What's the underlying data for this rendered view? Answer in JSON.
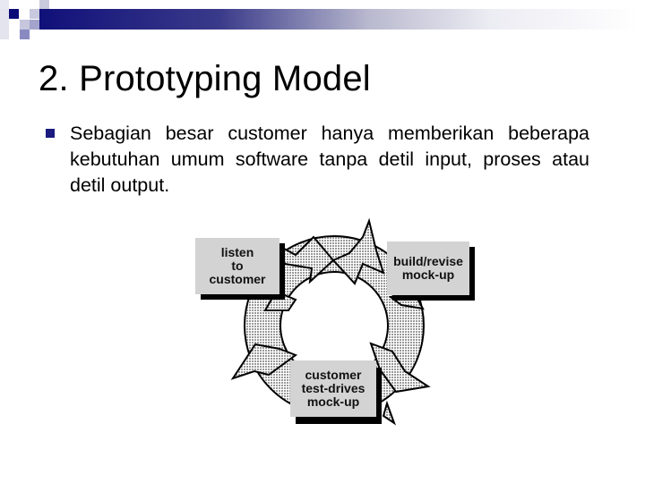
{
  "slide": {
    "title": "2. Prototyping Model",
    "bullets": [
      {
        "icon": "square-bullet-icon",
        "text": "Sebagian besar customer hanya memberikan beberapa kebutuhan umum software tanpa detil input, proses atau detil output."
      }
    ]
  },
  "colors": {
    "accent_dark": "#10107a",
    "bullet": "#1a1a80",
    "box_fill": "#d3d3d3"
  },
  "diagram": {
    "boxes": [
      {
        "id": "listen",
        "lines": [
          "listen",
          "to",
          "customer"
        ]
      },
      {
        "id": "build",
        "lines": [
          "build/revise",
          "mock-up"
        ]
      },
      {
        "id": "test",
        "lines": [
          "customer",
          "test-drives",
          "mock-up"
        ]
      }
    ],
    "cycle": "clockwise"
  }
}
